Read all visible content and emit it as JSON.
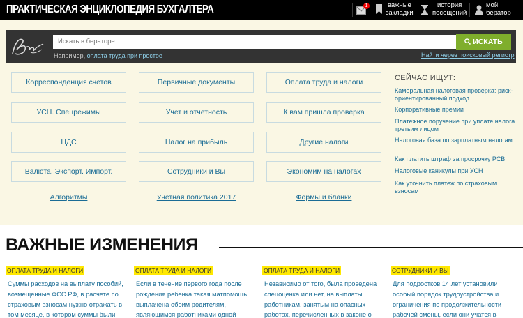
{
  "header": {
    "title": "ПРАКТИЧЕСКАЯ ЭНЦИКЛОПЕДИЯ БУХГАЛТЕРА",
    "notifications_count": "1",
    "bookmarks_label": "важные\nзакладки",
    "history_label": "история\nпосещений",
    "profile_label": "мой\nбератор"
  },
  "search": {
    "placeholder": "Искать в бераторе",
    "button_label": "ИСКАТЬ",
    "example_prefix": "Например,",
    "example_link": "оплата труда при простое",
    "register_link": "Найти через поисковый регистр"
  },
  "categories": [
    "Корреспонденция счетов",
    "Первичные документы",
    "Оплата труда и налоги",
    "УСН. Спецрежимы",
    "Учет и отчетность",
    "К вам пришла проверка",
    "НДС",
    "Налог на прибыль",
    "Другие налоги",
    "Валюта. Экспорт. Импорт.",
    "Сотрудники и Вы",
    "Экономим на налогах"
  ],
  "category_links": [
    "Алгоритмы",
    "Учетная политика 2017",
    "Формы и бланки"
  ],
  "now_searching": {
    "title": "СЕЙЧАС ИЩУТ:",
    "items": [
      "Камеральная налоговая проверка: риск-ориентированный подход",
      "Корпоративные премии",
      "Платежное поручение при уплате налога третьим лицом",
      "Налоговая база по зарплатным налогам",
      "Как платить штраф за просрочку РСВ",
      "Налоговые каникулы при УСН",
      "Как уточнить платеж по страховым взносам"
    ]
  },
  "changes": {
    "title": "ВАЖНЫЕ ИЗМЕНЕНИЯ",
    "news": [
      {
        "tag": "ОПЛАТА ТРУДА И НАЛОГИ",
        "text": "Суммы расходов на выплату пособий, возмещенные ФСС РФ, в расчете по страховым взносам нужно отражать в том месяце, в котором суммы были"
      },
      {
        "tag": "ОПЛАТА ТРУДА И НАЛОГИ",
        "text": "Если в течение первого года после рождения ребенка такая матпомощь выплачена обоим родителям, являющимся работниками одной"
      },
      {
        "tag": "ОПЛАТА ТРУДА И НАЛОГИ",
        "text": "Независимо от того, была проведена спецоценка или нет, на выплаты работникам, занятым на опасных работах, перечисленных в законе о"
      },
      {
        "tag": "СОТРУДНИКИ И ВЫ",
        "text": "Для подростков 14 лет установили особый порядок трудоустройства и ограничения по продолжительности рабочей смены, если они учатся в"
      }
    ]
  }
}
